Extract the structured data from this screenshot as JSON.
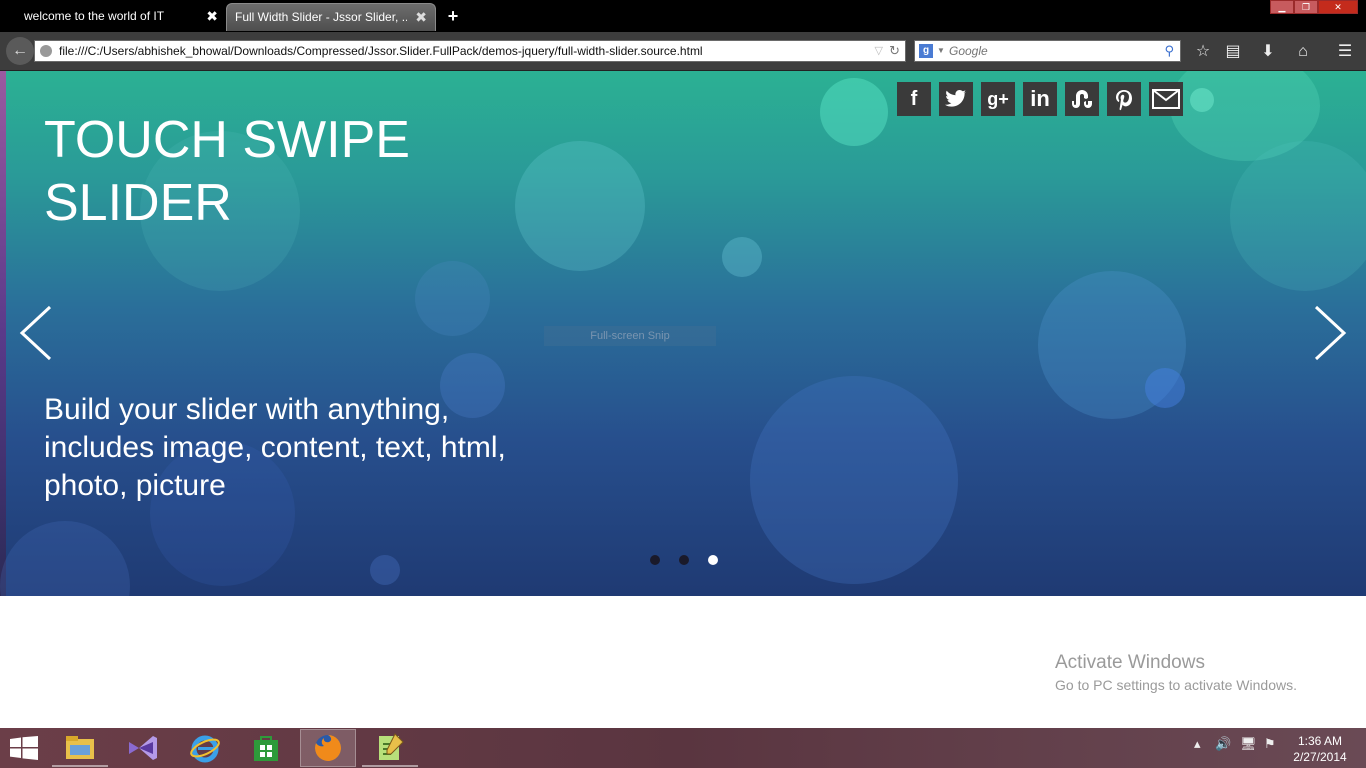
{
  "browser": {
    "tabs": [
      {
        "title": "welcome to the world of IT",
        "close": "✖"
      },
      {
        "title": "Full Width Slider - Jssor Slider, ...",
        "close": "✖"
      }
    ],
    "new_tab": "+",
    "url": "file:///C:/Users/abhishek_bhowal/Downloads/Compressed/Jssor.Slider.FullPack/demos-jquery/full-width-slider.source.html",
    "search_placeholder": "Google",
    "search_engine_icon": "google-icon",
    "toolbar_icons": [
      "bookmark-star-icon",
      "reading-list-icon",
      "download-icon",
      "home-icon",
      "menu-icon"
    ]
  },
  "slider": {
    "headline": "TOUCH SWIPE SLIDER",
    "subtext": "Build your slider with anything, includes image, content, text, html, photo, picture",
    "active_slide": 3,
    "slide_count": 3,
    "social_icons": [
      "facebook-icon",
      "twitter-icon",
      "google-plus-icon",
      "linkedin-icon",
      "stumbleupon-icon",
      "pinterest-icon",
      "email-icon"
    ],
    "snip_label": "Full-screen Snip"
  },
  "watermark": {
    "title": "Activate Windows",
    "subtitle": "Go to PC settings to activate Windows."
  },
  "taskbar": {
    "apps": [
      "file-explorer-icon",
      "visual-studio-icon",
      "internet-explorer-icon",
      "store-icon",
      "firefox-icon",
      "notepad-plus-plus-icon"
    ],
    "time": "1:36 AM",
    "date": "2/27/2014"
  },
  "colors": {
    "slider_top": "#2bb193",
    "slider_bottom": "#1f3a73",
    "taskbar": "#5a3540",
    "tab_bar": "#000000"
  }
}
